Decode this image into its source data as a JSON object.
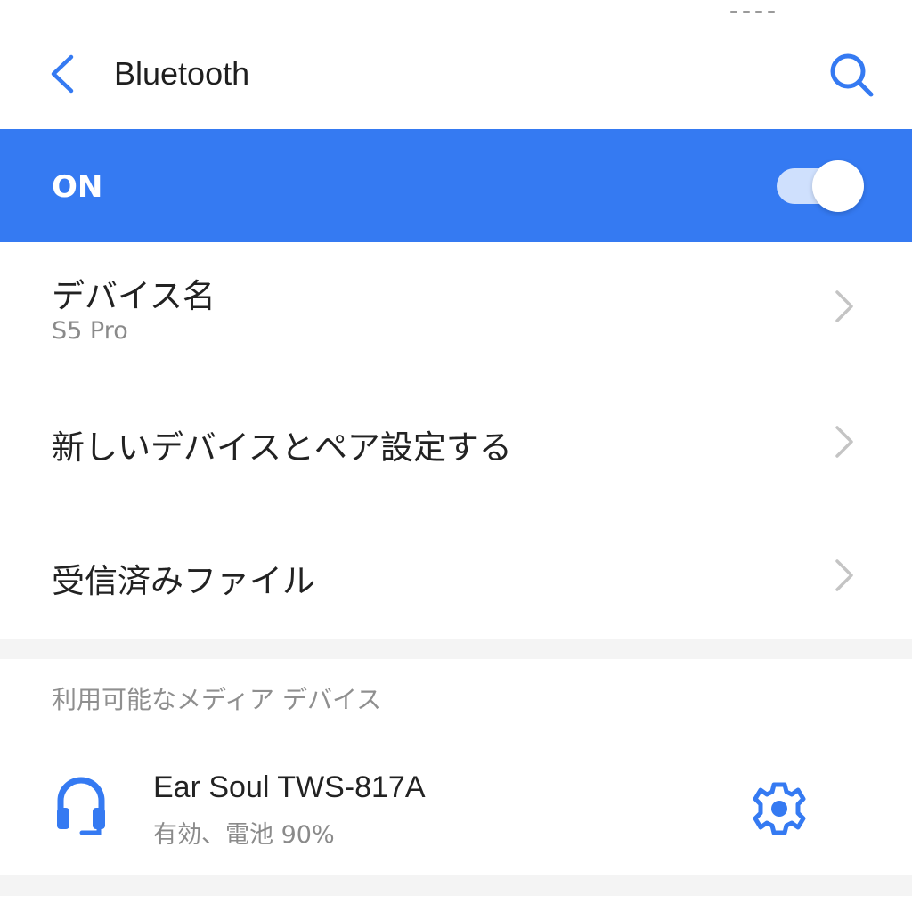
{
  "header": {
    "title": "Bluetooth",
    "back_icon": "chevron-left-icon",
    "search_icon": "search-icon"
  },
  "master_switch": {
    "label": "ON",
    "state": true
  },
  "settings_rows": [
    {
      "label": "デバイス名",
      "sublabel": "S5 Pro"
    },
    {
      "label": "新しいデバイスとペア設定する"
    },
    {
      "label": "受信済みファイル"
    }
  ],
  "available_media_devices": {
    "header": "利用可能なメディア デバイス",
    "devices": [
      {
        "name": "Ear Soul TWS-817A",
        "status": "有効、電池 90%",
        "icon": "headset-icon",
        "action_icon": "gear-icon"
      }
    ]
  },
  "colors": {
    "accent": "#357af2",
    "toggle_track": "#cfe0fd",
    "section_gap": "#f4f4f4",
    "secondary_text": "#8a8a8a"
  }
}
